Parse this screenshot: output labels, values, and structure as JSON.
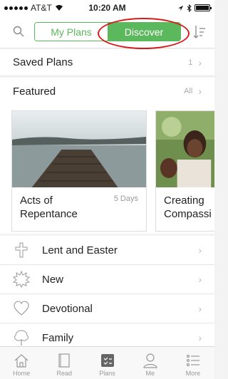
{
  "status_bar": {
    "carrier": "AT&T",
    "time": "10:20 AM"
  },
  "top_bar": {
    "tabs": [
      {
        "label": "My Plans",
        "active": false
      },
      {
        "label": "Discover",
        "active": true
      }
    ],
    "icons": [
      "search-icon",
      "sort-icon"
    ]
  },
  "saved_plans": {
    "label": "Saved Plans",
    "count": "1"
  },
  "featured": {
    "label": "Featured",
    "link": "All",
    "cards": [
      {
        "title": "Acts of Repentance",
        "days": "5 Days",
        "image": "wooden-dock-lake-photo"
      },
      {
        "title": "Creating Compassi",
        "days": "",
        "image": "children-photo"
      }
    ]
  },
  "categories": [
    {
      "label": "Lent and Easter",
      "icon": "cross-icon"
    },
    {
      "label": "New",
      "icon": "starburst-icon"
    },
    {
      "label": "Devotional",
      "icon": "heart-icon"
    },
    {
      "label": "Family",
      "icon": "tree-icon"
    }
  ],
  "tab_bar": [
    {
      "label": "Home",
      "icon": "home-icon"
    },
    {
      "label": "Read",
      "icon": "book-icon"
    },
    {
      "label": "Plans",
      "icon": "plans-icon",
      "active": true
    },
    {
      "label": "Me",
      "icon": "person-icon"
    },
    {
      "label": "More",
      "icon": "list-icon"
    }
  ],
  "colors": {
    "accent": "#5cb85c",
    "highlight": "#d91a1a"
  }
}
